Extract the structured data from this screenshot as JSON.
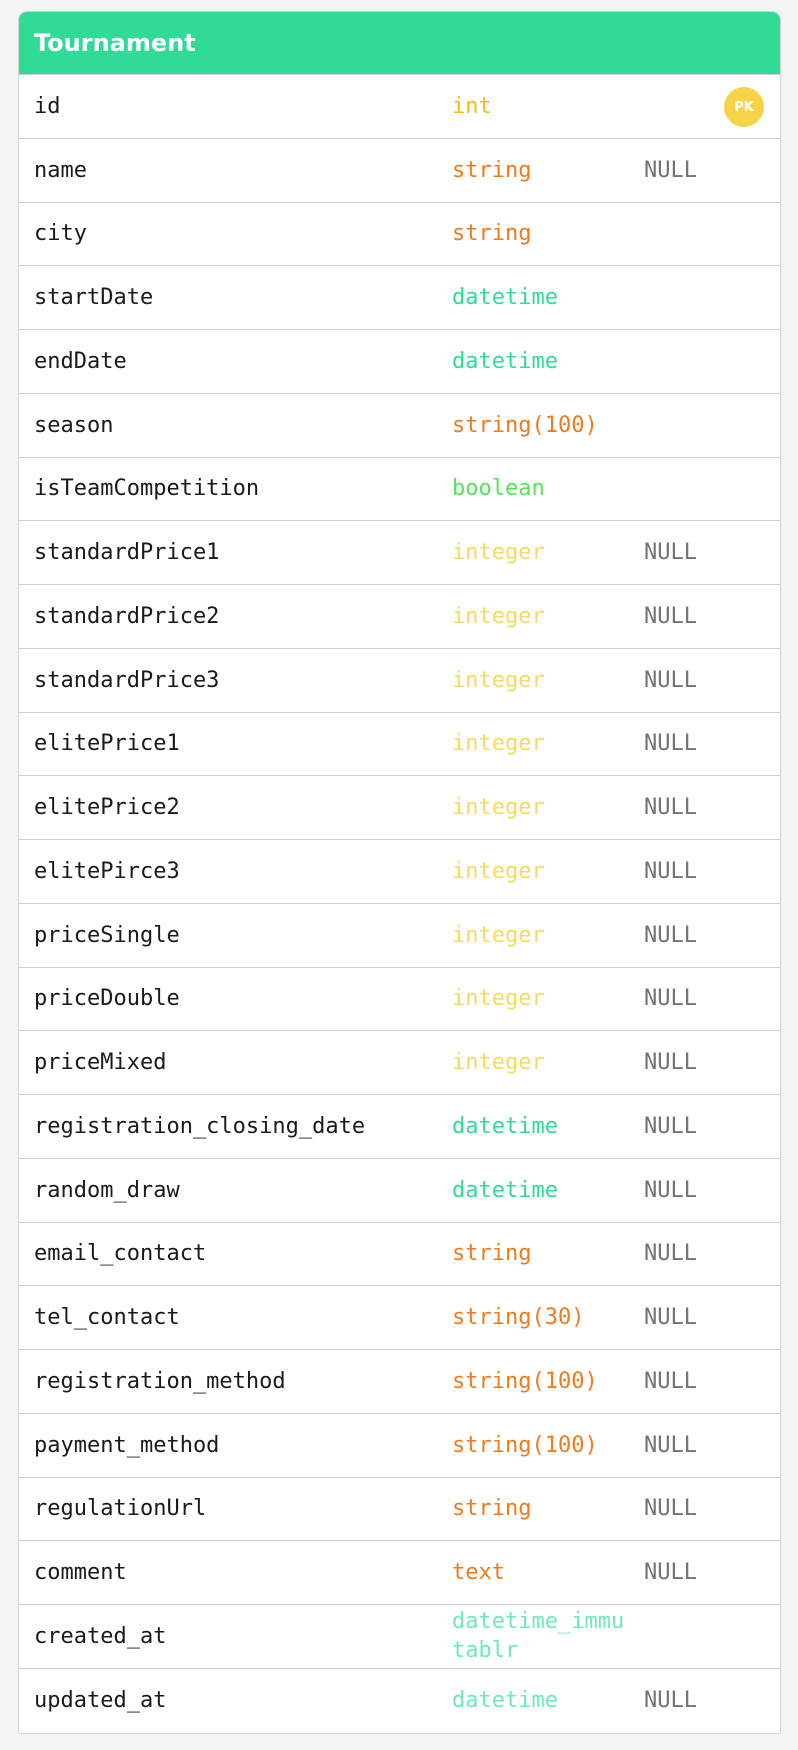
{
  "table": {
    "title": "Tournament",
    "fields": [
      {
        "name": "id",
        "type": "int",
        "color": "#f0bd1f",
        "badge": "PK"
      },
      {
        "name": "name",
        "type": "string",
        "color": "#f07a1c",
        "nullable": "NULL"
      },
      {
        "name": "city",
        "type": "string",
        "color": "#f07a1c"
      },
      {
        "name": "startDate",
        "type": "datetime",
        "color": "#2fdb96"
      },
      {
        "name": "endDate",
        "type": "datetime",
        "color": "#2fdb96"
      },
      {
        "name": "season",
        "type": "string(100)",
        "color": "#f07a1c"
      },
      {
        "name": "isTeamCompetition",
        "type": "boolean",
        "color": "#57e35a"
      },
      {
        "name": "standardPrice1",
        "type": "integer",
        "color": "#f7da5e",
        "nullable": "NULL"
      },
      {
        "name": "standardPrice2",
        "type": "integer",
        "color": "#f7da5e",
        "nullable": "NULL"
      },
      {
        "name": "standardPrice3",
        "type": "integer",
        "color": "#f7da5e",
        "nullable": "NULL"
      },
      {
        "name": "elitePrice1",
        "type": "integer",
        "color": "#f7da5e",
        "nullable": "NULL"
      },
      {
        "name": "elitePrice2",
        "type": "integer",
        "color": "#f7da5e",
        "nullable": "NULL"
      },
      {
        "name": "elitePirce3",
        "type": "integer",
        "color": "#f7da5e",
        "nullable": "NULL"
      },
      {
        "name": "priceSingle",
        "type": "integer",
        "color": "#f7da5e",
        "nullable": "NULL"
      },
      {
        "name": "priceDouble",
        "type": "integer",
        "color": "#f7da5e",
        "nullable": "NULL"
      },
      {
        "name": "priceMixed",
        "type": "integer",
        "color": "#f7da5e",
        "nullable": "NULL"
      },
      {
        "name": "registration_closing_date",
        "type": "datetime",
        "color": "#2fdb96",
        "nullable": "NULL"
      },
      {
        "name": "random_draw",
        "type": "datetime",
        "color": "#2fdb96",
        "nullable": "NULL"
      },
      {
        "name": "email_contact",
        "type": "string",
        "color": "#f07a1c",
        "nullable": "NULL"
      },
      {
        "name": "tel_contact",
        "type": "string(30)",
        "color": "#f07a1c",
        "nullable": "NULL"
      },
      {
        "name": "registration_method",
        "type": "string(100)",
        "color": "#f07a1c",
        "nullable": "NULL"
      },
      {
        "name": "payment_method",
        "type": "string(100)",
        "color": "#f07a1c",
        "nullable": "NULL"
      },
      {
        "name": "regulationUrl",
        "type": "string",
        "color": "#f07a1c",
        "nullable": "NULL"
      },
      {
        "name": "comment",
        "type": "text",
        "color": "#f07a1c",
        "nullable": "NULL"
      },
      {
        "name": "created_at",
        "type": "datetime_immutablr",
        "color": "#6de8bf"
      },
      {
        "name": "updated_at",
        "type": "datetime",
        "color": "#6de8bf",
        "nullable": "NULL"
      }
    ]
  }
}
